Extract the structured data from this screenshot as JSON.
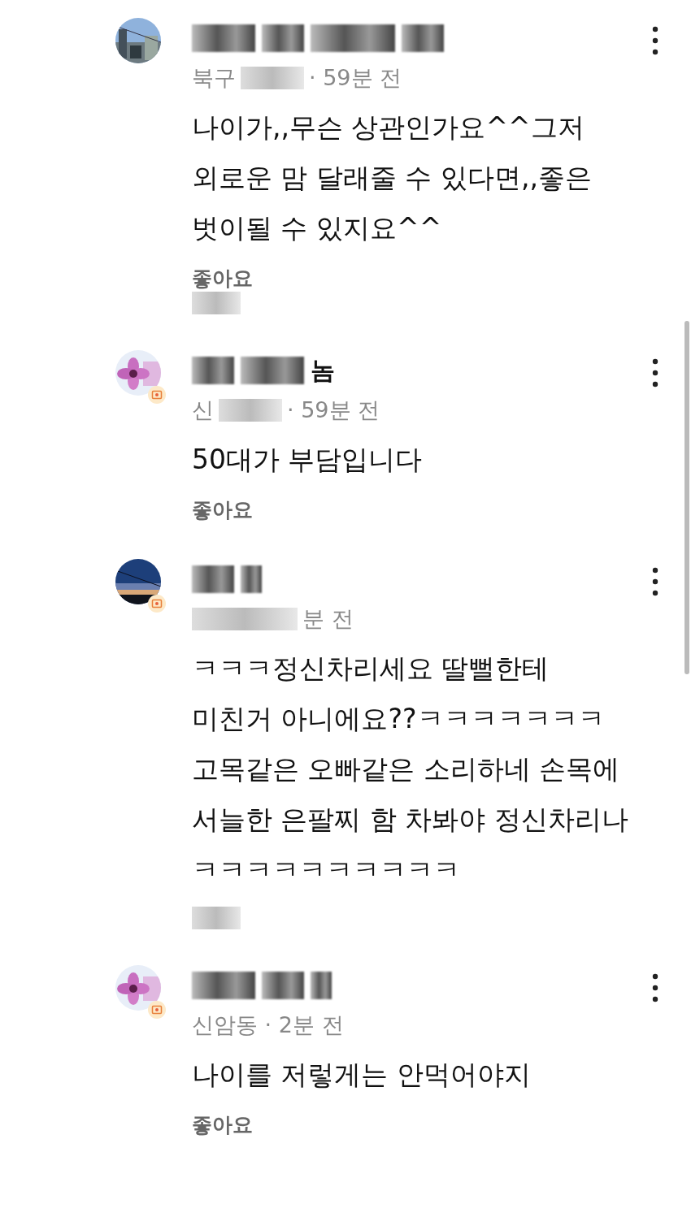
{
  "comments": [
    {
      "avatar": {
        "kind": "sky"
      },
      "badge": false,
      "meta": [
        {
          "kind": "text",
          "text": "북구"
        },
        {
          "kind": "blur"
        },
        {
          "kind": "text",
          "text": "· 59분 전"
        }
      ],
      "lines": [
        "나이가,,무슨 상관인가요^^그저",
        "외로운 맘 달래줄 수 있다면,,좋은",
        "벗이될 수 있지요^^"
      ],
      "like": {
        "label": "좋아요",
        "blurred": true
      }
    },
    {
      "avatar": {
        "kind": "flower"
      },
      "badge": true,
      "name_visible": "놈",
      "meta": [
        {
          "kind": "text",
          "text": "신"
        },
        {
          "kind": "blur"
        },
        {
          "kind": "text",
          "text": "· 59분 전"
        }
      ],
      "lines": [
        "50대가 부담입니다"
      ],
      "like": {
        "label": "좋아요",
        "blurred": false
      }
    },
    {
      "avatar": {
        "kind": "dusk"
      },
      "badge": true,
      "meta": [
        {
          "kind": "blur"
        },
        {
          "kind": "text",
          "text": "분 전"
        }
      ],
      "lines": [
        "ㅋㅋㅋ정신차리세요 딸뻘한테",
        "미친거 아니에요??ㅋㅋㅋㅋㅋㅋㅋ",
        "고목같은 오빠같은 소리하네 손목에",
        "서늘한 은팔찌 함 차봐야 정신차리나",
        "ㅋㅋㅋㅋㅋㅋㅋㅋㅋㅋ"
      ],
      "like": {
        "blurred": true
      }
    },
    {
      "avatar": {
        "kind": "flower"
      },
      "badge": true,
      "meta": [
        {
          "kind": "text",
          "text": "신암동 · 2분 전"
        }
      ],
      "lines": [
        "나이를 저렇게는 안먹어야지"
      ],
      "like": {
        "label": "좋아요",
        "blurred": false
      }
    }
  ]
}
